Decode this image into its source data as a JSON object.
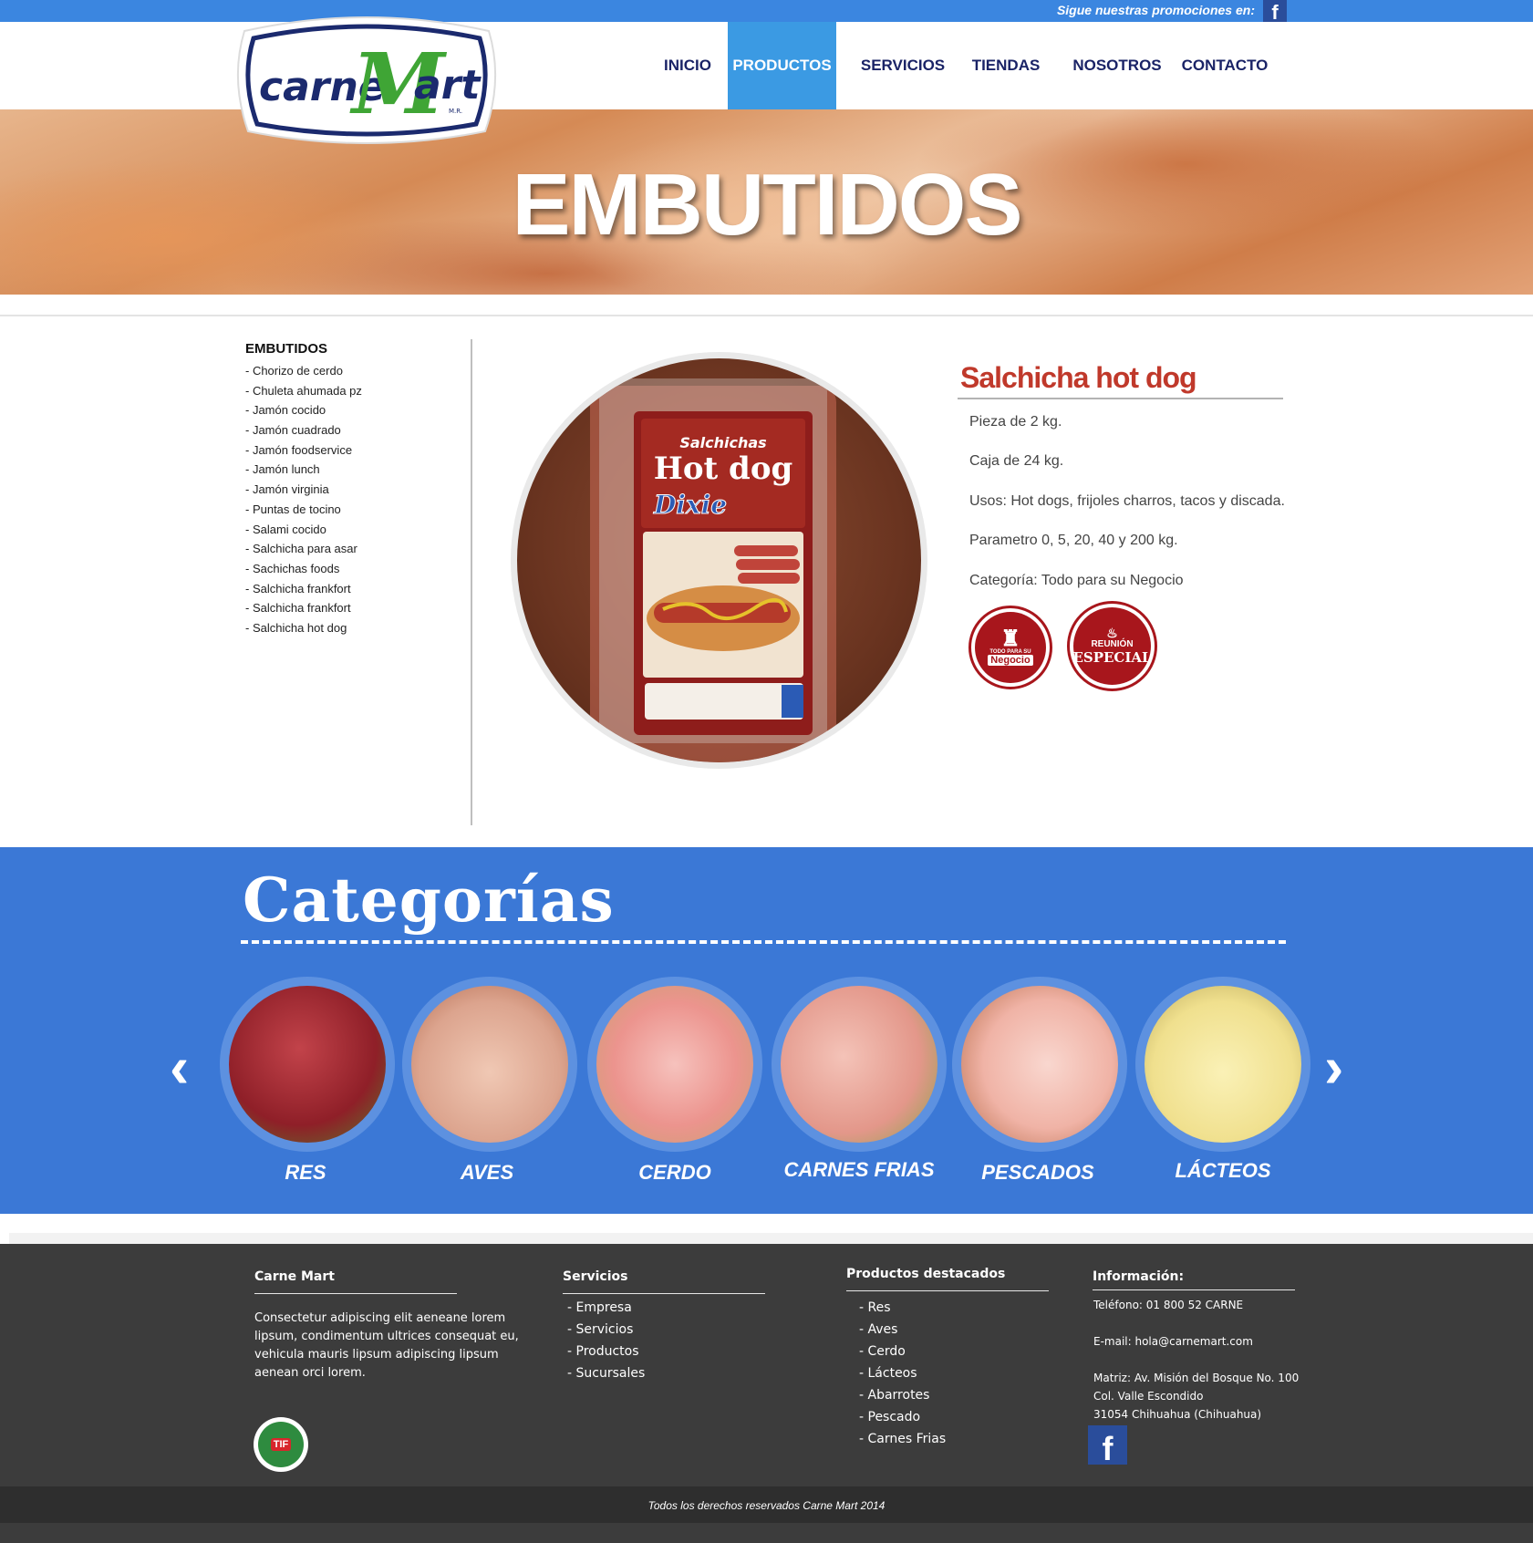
{
  "topbar": {
    "promo_text": "Sigue nuestras promociones en:",
    "facebook_glyph": "f"
  },
  "logo": {
    "word1": "carne",
    "word2": "M",
    "word3": "art",
    "mark": "M.R."
  },
  "nav": [
    {
      "label": "INICIO",
      "active": false
    },
    {
      "label": "PRODUCTOS",
      "active": true
    },
    {
      "label": "SERVICIOS",
      "active": false
    },
    {
      "label": "TIENDAS",
      "active": false
    },
    {
      "label": "NOSOTROS",
      "active": false
    },
    {
      "label": "CONTACTO",
      "active": false
    }
  ],
  "hero": {
    "title": "EMBUTIDOS"
  },
  "sidebar": {
    "title": "EMBUTIDOS",
    "items": [
      "- Chorizo de cerdo",
      "- Chuleta ahumada pz",
      "- Jamón cocido",
      "- Jamón cuadrado",
      "- Jamón foodservice",
      "- Jamón lunch",
      "- Jamón virginia",
      "- Puntas de tocino",
      "- Salami cocido",
      "- Salchicha para asar",
      "- Sachichas foods",
      "- Salchicha frankfort",
      "- Salchicha frankfort",
      "- Salchicha hot dog"
    ]
  },
  "product": {
    "package_top": "Salchichas",
    "package_main": "Hot dog",
    "package_brand": "Dixie",
    "title": "Salchicha hot dog",
    "lines": [
      "Pieza de 2 kg.",
      "Caja de 24 kg.",
      "Usos: Hot dogs, frijoles charros, tacos y discada.",
      "Parametro 0, 5, 20, 40 y 200 kg.",
      "Categoría: Todo para su Negocio"
    ],
    "badges": [
      {
        "small": "TODO PARA SU",
        "main": "Negocio"
      },
      {
        "small": "REUNIÓN",
        "main": "ESPECIAL"
      }
    ]
  },
  "categories": {
    "title": "Categorías",
    "prev_glyph": "‹",
    "next_glyph": "›",
    "items": [
      {
        "label": "RES",
        "color": "#b5333a"
      },
      {
        "label": "AVES",
        "color": "#e8b7a0"
      },
      {
        "label": "CERDO",
        "color": "#f0a3a0"
      },
      {
        "label": "CARNES FRIAS",
        "color": "#e8a9a0"
      },
      {
        "label": "PESCADOS",
        "color": "#f4c8bd"
      },
      {
        "label": "LÁCTEOS",
        "color": "#f1e59a"
      }
    ]
  },
  "footer": {
    "col1": {
      "heading": "Carne Mart",
      "text": [
        "Consectetur adipiscing elit aeneane lorem",
        "lipsum, condimentum ultrices consequat eu,",
        "vehicula mauris lipsum adipiscing lipsum",
        "aenean orci lorem."
      ],
      "seal_text": "TIF"
    },
    "col2": {
      "heading": "Servicios",
      "items": [
        "- Empresa",
        "- Servicios",
        "- Productos",
        "- Sucursales"
      ]
    },
    "col3": {
      "heading": "Productos destacados",
      "items": [
        "- Res",
        "- Aves",
        "- Cerdo",
        "- Lácteos",
        "- Abarrotes",
        "- Pescado",
        "- Carnes Frias"
      ]
    },
    "col4": {
      "heading": "Información:",
      "phone": "Teléfono: 01 800 52 CARNE",
      "email": "E-mail: hola@carnemart.com",
      "address": [
        "Matriz: Av. Misión del Bosque No. 100",
        "Col. Valle Escondido",
        "31054 Chihuahua (Chihuahua)"
      ],
      "facebook_glyph": "f"
    },
    "copyright": "Todos los derechos reservados Carne Mart 2014"
  }
}
